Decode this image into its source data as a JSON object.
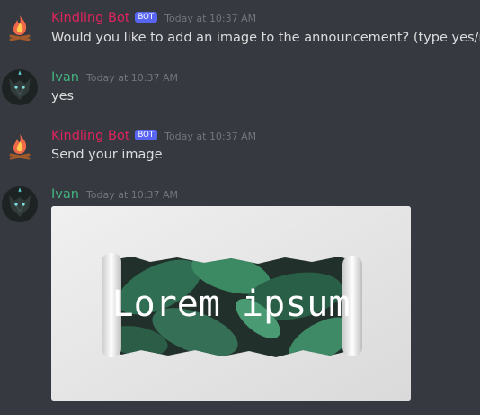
{
  "messages": [
    {
      "username": "Kindling Bot",
      "username_color": "#e0245e",
      "badge": "BOT",
      "timestamp": "Today at 10:37 AM",
      "content": "Would you like to add an image to the announcement? (type yes/no)",
      "avatar_icon": "campfire-icon"
    },
    {
      "username": "Ivan",
      "username_color": "#43b581",
      "timestamp": "Today at 10:37 AM",
      "content": "yes",
      "avatar_icon": "wolf-avatar"
    },
    {
      "username": "Kindling Bot",
      "username_color": "#e0245e",
      "badge": "BOT",
      "timestamp": "Today at 10:37 AM",
      "content": "Send your image",
      "avatar_icon": "campfire-icon"
    },
    {
      "username": "Ivan",
      "username_color": "#43b581",
      "timestamp": "Today at 10:37 AM",
      "avatar_icon": "wolf-avatar",
      "attachment": {
        "text": "Lorem ipsum"
      }
    }
  ]
}
